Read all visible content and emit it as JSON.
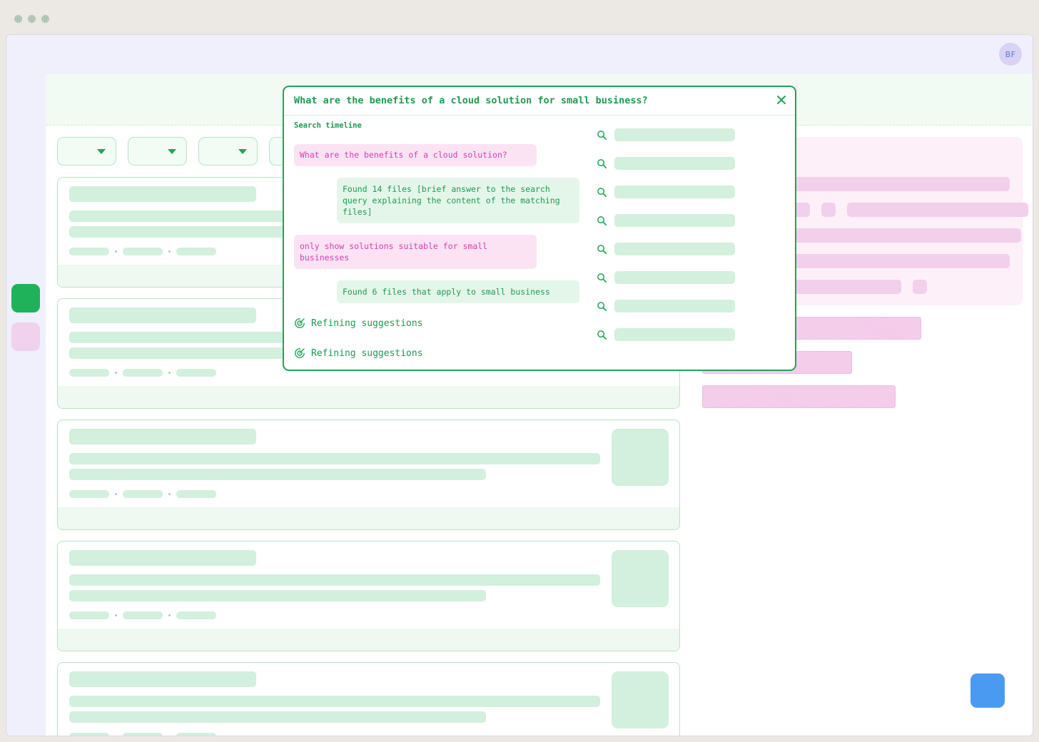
{
  "window": {
    "avatar_initials": "BF",
    "traffic_light_count": 3
  },
  "colors": {
    "accent": "#1fa356",
    "user_bubble": "#fbe3f4",
    "system_bubble": "#e4f6ea",
    "fab": "#4b9af2"
  },
  "filters": [
    {
      "icon": "caret-down-icon"
    },
    {
      "icon": "caret-down-icon"
    },
    {
      "icon": "caret-down-icon"
    },
    {
      "icon": "caret-down-icon"
    }
  ],
  "dialog": {
    "title": "What are the benefits of a cloud solution for small business?",
    "close_icon": "close-icon",
    "timeline_label": "Search timeline",
    "messages": [
      {
        "role": "user",
        "text": "What are the benefits of a cloud solution?"
      },
      {
        "role": "system",
        "text": "Found 14 files [brief answer to the search query explaining the content of the matching files]"
      },
      {
        "role": "user",
        "text": "only show solutions suitable for small businesses"
      },
      {
        "role": "system",
        "text": "Found 6 files that apply to small business"
      }
    ],
    "status": [
      "Refining suggestions",
      "Refining suggestions"
    ],
    "search_results_icon": "search-icon",
    "search_result_count": 8
  }
}
